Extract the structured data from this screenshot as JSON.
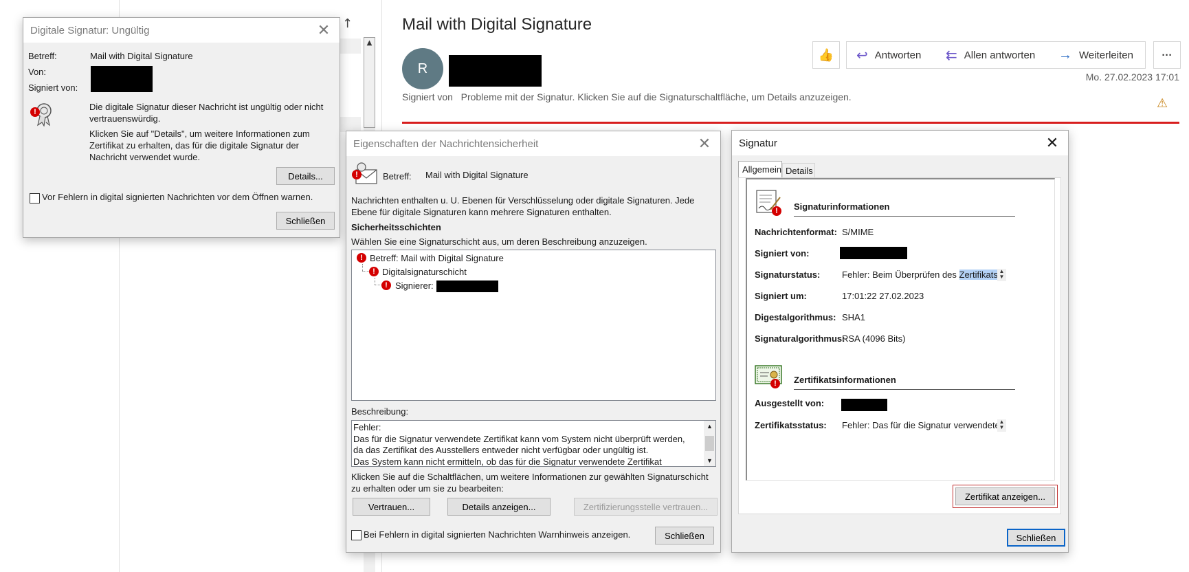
{
  "mail": {
    "title": "Mail with Digital Signature",
    "avatar_letter": "R",
    "signed_label": "Signiert von",
    "signed_problem": "Probleme mit der Signatur. Klicken Sie auf die Signaturschaltfläche, um Details anzuzeigen.",
    "buttons": {
      "reply": "Antworten",
      "reply_all": "Allen antworten",
      "forward": "Weiterleiten",
      "more": "···"
    },
    "date": "Mo. 27.02.2023 17:01",
    "icons": {
      "like": "thumbs-up-icon",
      "reply": "reply-arrow-icon",
      "reply_all": "reply-all-icon",
      "forward": "forward-arrow-icon",
      "warning": "warning-icon"
    },
    "accent": "#d81e1e"
  },
  "dlg1": {
    "title": "Digitale Signatur: Ungültig",
    "subject_label": "Betreff:",
    "subject_value": "Mail with Digital Signature",
    "from_label": "Von:",
    "signed_label": "Signiert von:",
    "msg1": "Die digitale Signatur dieser Nachricht ist ungültig oder nicht vertrauenswürdig.",
    "msg2": "Klicken Sie auf \"Details\", um weitere Informationen zum Zertifikat zu erhalten, das für die digitale Signatur der Nachricht verwendet wurde.",
    "details_btn": "Details...",
    "warn_check": "Vor Fehlern in digital signierten Nachrichten vor dem Öffnen warnen.",
    "close_btn": "Schließen"
  },
  "dlg2": {
    "title": "Eigenschaften der Nachrichtensicherheit",
    "subject_label": "Betreff:",
    "subject_value": "Mail with Digital Signature",
    "intro": "Nachrichten enthalten u. U. Ebenen für Verschlüsselung oder digitale Signaturen. Jede Ebene für digitale Signaturen kann mehrere Signaturen enthalten.",
    "layers_heading": "Sicherheitsschichten",
    "layers_hint": "Wählen Sie eine Signaturschicht aus, um deren Beschreibung anzuzeigen.",
    "tree": [
      "Betreff: Mail with Digital Signature",
      "Digitalsignaturschicht",
      "Signierer:"
    ],
    "desc_label": "Beschreibung:",
    "desc_text": "Fehler:\nDas für die Signatur verwendete Zertifikat kann vom System nicht überprüft werden, da das Zertifikat des Ausstellers entweder nicht verfügbar oder ungültig ist.\nDas System kann nicht ermitteln, ob das für die Signatur verwendete Zertifikat",
    "action_hint": "Klicken Sie auf die Schaltflächen, um weitere Informationen zur gewählten Signaturschicht zu erhalten oder um sie zu bearbeiten:",
    "trust_btn": "Vertrauen...",
    "details_btn": "Details anzeigen...",
    "ca_btn": "Zertifizierungsstelle vertrauen...",
    "warn_check": "Bei Fehlern in digital signierten Nachrichten Warnhinweis anzeigen.",
    "close_btn": "Schließen"
  },
  "dlg3": {
    "title": "Signatur",
    "tabs": [
      "Allgemein",
      "Details"
    ],
    "sig_heading": "Signaturinformationen",
    "rows": [
      {
        "label": "Nachrichtenformat:",
        "value": "S/MIME"
      },
      {
        "label": "Signiert von:",
        "value": ""
      },
      {
        "label": "Signaturstatus:",
        "value": "Fehler: Beim Überprüfen des",
        "highlight": "Zertifikats",
        "tail": ","
      },
      {
        "label": "Signiert um:",
        "value": "17:01:22 27.02.2023"
      },
      {
        "label": "Digestalgorithmus:",
        "value": "SHA1"
      },
      {
        "label": "Signaturalgorithmus:",
        "value": "RSA (4096 Bits)"
      }
    ],
    "cert_heading": "Zertifikatsinformationen",
    "issued_label": "Ausgestellt von:",
    "cert_status_label": "Zertifikatsstatus:",
    "cert_status_value": "Fehler: Das für die Signatur verwendete",
    "show_cert_btn": "Zertifikat anzeigen...",
    "close_btn": "Schließen"
  }
}
